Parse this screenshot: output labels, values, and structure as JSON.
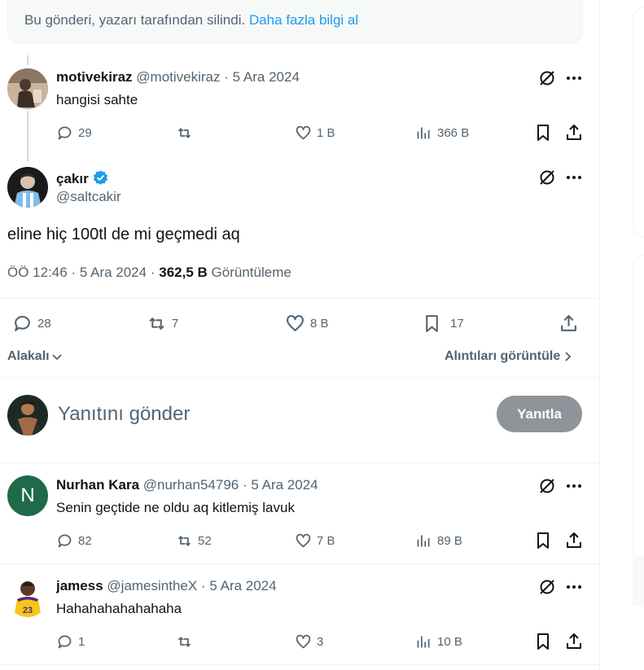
{
  "notice": {
    "text": "Bu gönderi, yazarı tarafından silindi.",
    "link": "Daha fazla bilgi al"
  },
  "parent": {
    "name": "motivekiraz",
    "handle": "@motivekiraz",
    "sep": "·",
    "date": "5 Ara 2024",
    "text": "hangisi sahte",
    "replies": "29",
    "reposts": "",
    "likes": "1 B",
    "views": "366 B"
  },
  "main": {
    "name": "çakır",
    "handle": "@saltcakir",
    "text": "eline hiç 100tl de mi geçmedi aq",
    "time": "ÖÖ 12:46",
    "sep1": "·",
    "date": "5 Ara 2024",
    "sep2": "·",
    "views": "362,5 B",
    "views_label": "Görüntüleme",
    "replies": "28",
    "reposts": "7",
    "likes": "8 B",
    "bookmarks": "17"
  },
  "sort": {
    "relevant": "Alakalı",
    "quotes": "Alıntıları görüntüle"
  },
  "compose": {
    "placeholder": "Yanıtını gönder",
    "button": "Yanıtla"
  },
  "replies": [
    {
      "name": "Nurhan Kara",
      "handle": "@nurhan54796",
      "sep": "·",
      "date": "5 Ara 2024",
      "initial": "N",
      "avatar_color": "#1e6a49",
      "text": "Senin geçtide ne oldu aq kitlemiş lavuk",
      "replies": "82",
      "reposts": "52",
      "likes": "7 B",
      "views": "89 B"
    },
    {
      "name": "jamess",
      "handle": "@jamesintheX",
      "sep": "·",
      "date": "5 Ara 2024",
      "jersey": "23",
      "text": "Hahahahahahahaha",
      "replies": "1",
      "reposts": "",
      "likes": "3",
      "views": "10 B"
    }
  ],
  "colors": {
    "accent": "#1d9bf0",
    "text": "#0f1419",
    "muted": "#536471",
    "button_disabled": "#8e9499"
  }
}
